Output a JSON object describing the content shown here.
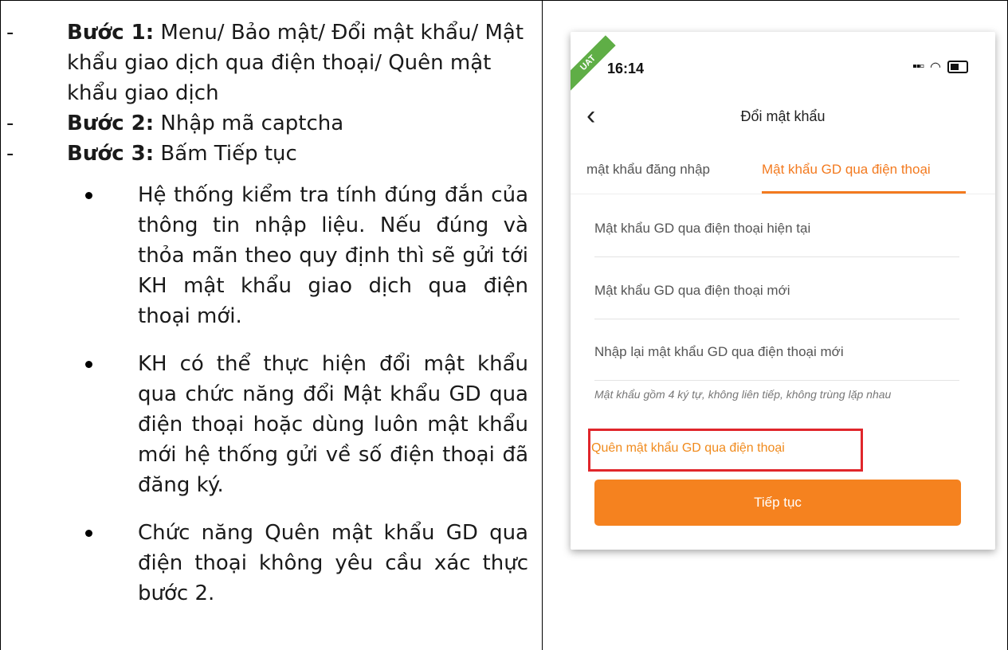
{
  "steps": [
    {
      "dash": "-",
      "label": "Bước 1:",
      "text": " Menu/ Bảo mật/ Đổi mật khẩu/ Mật khẩu giao dịch qua điện thoại/ Quên mật khẩu giao dịch"
    },
    {
      "dash": "-",
      "label": "Bước 2:",
      "text": " Nhập mã captcha"
    },
    {
      "dash": "-",
      "label": "Bước 3:",
      "text": " Bấm Tiếp tục"
    }
  ],
  "bullets": [
    "Hệ thống kiểm tra tính đúng đắn của thông tin nhập liệu. Nếu đúng và thỏa mãn theo quy định thì sẽ gửi tới KH mật khẩu giao dịch qua điện thoại mới.",
    "KH có thể thực hiện đổi mật khẩu qua chức năng đổi Mật khẩu GD qua điện thoại hoặc dùng luôn mật khẩu mới hệ thống gửi về số điện thoại đã đăng ký.",
    "Chức năng Quên mật khẩu GD qua điện thoại không yêu cầu xác thực bước 2."
  ],
  "phone": {
    "env_badge": "UAT",
    "time": "16:14",
    "back_icon": "‹",
    "title": "Đổi mật khẩu",
    "tabs": [
      "mật khẩu đăng nhập",
      "Mật khẩu GD qua điện thoại"
    ],
    "fields": [
      "Mật khẩu GD qua điện thoại hiện tại",
      "Mật khẩu GD qua điện thoại mới",
      "Nhập lại mật khẩu GD qua điện thoại mới"
    ],
    "note": "Mật khẩu gồm 4 ký tự, không liên tiếp, không trùng lặp nhau",
    "forgot_link": "Quên mật khẩu GD qua điện thoại",
    "continue_button": "Tiếp tục",
    "colors": {
      "accent": "#f5821f",
      "highlight_box": "#e0262b"
    }
  }
}
